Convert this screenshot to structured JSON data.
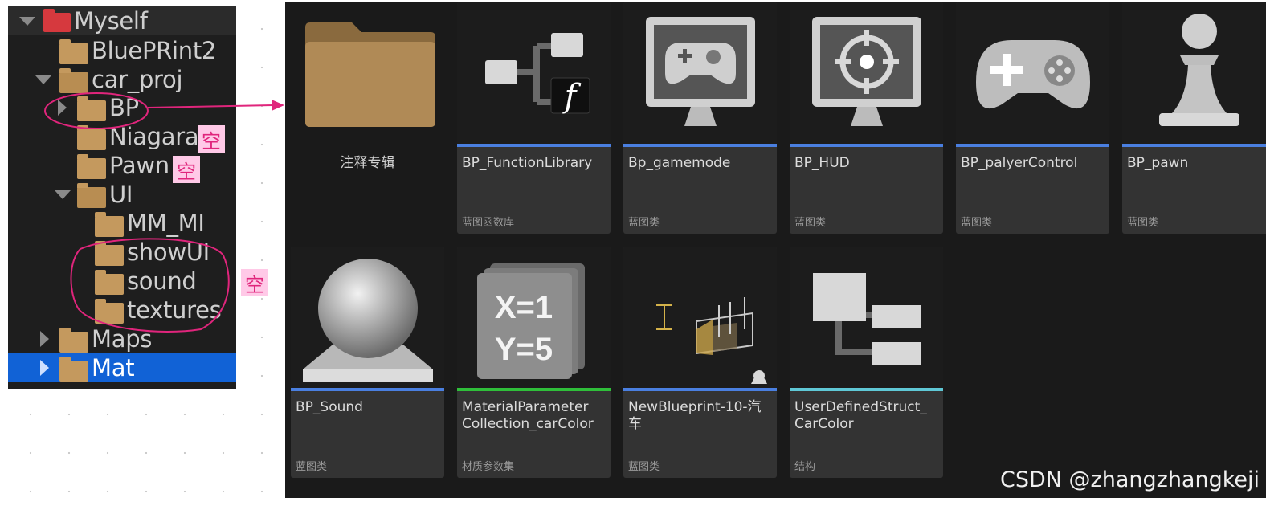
{
  "tree": {
    "items": [
      {
        "label": "Myself"
      },
      {
        "label": "BluePRint2"
      },
      {
        "label": "car_proj"
      },
      {
        "label": "BP"
      },
      {
        "label": "Niagara"
      },
      {
        "label": "Pawn"
      },
      {
        "label": "UI"
      },
      {
        "label": "MM_MI"
      },
      {
        "label": "showUI"
      },
      {
        "label": "sound"
      },
      {
        "label": "textures"
      },
      {
        "label": "Maps"
      },
      {
        "label": "Mat"
      }
    ],
    "selected": "Mat"
  },
  "annotations": {
    "empty_tag_1": "空",
    "empty_tag_2": "空",
    "empty_tag_3": "空",
    "color": "#e0257c"
  },
  "assets": [
    {
      "name": "注释专辑",
      "type": "",
      "kind": "folder"
    },
    {
      "name": "BP_FunctionLibrary",
      "type": "蓝图函数库",
      "bar_color": "#4a7fe0"
    },
    {
      "name": "Bp_gamemode",
      "type": "蓝图类",
      "bar_color": "#4a7fe0"
    },
    {
      "name": "BP_HUD",
      "type": "蓝图类",
      "bar_color": "#4a7fe0"
    },
    {
      "name": "BP_palyerControl",
      "type": "蓝图类",
      "bar_color": "#4a7fe0"
    },
    {
      "name": "BP_pawn",
      "type": "蓝图类",
      "bar_color": "#4a7fe0"
    },
    {
      "name": "BP_Sound",
      "type": "蓝图类",
      "bar_color": "#4a7fe0"
    },
    {
      "name": "MaterialParameter Collection_carColor",
      "type": "材质参数集",
      "bar_color": "#2fbf3a"
    },
    {
      "name": "NewBlueprint-10-汽车",
      "type": "蓝图类",
      "bar_color": "#4a7fe0"
    },
    {
      "name": "UserDefinedStruct_ CarColor",
      "type": "结构",
      "bar_color": "#5fc8d6"
    }
  ],
  "thumb_text": {
    "x": "X=1",
    "y": "Y=5",
    "f": "f"
  },
  "watermark": "CSDN @zhangzhangkeji"
}
